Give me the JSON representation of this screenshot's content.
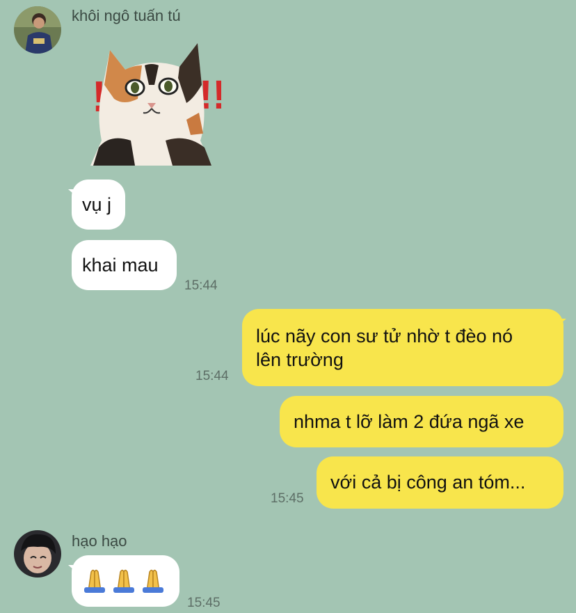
{
  "colors": {
    "background": "#a3c5b3",
    "incoming": "#ffffff",
    "outgoing": "#f8e54c"
  },
  "messages": {
    "group1": {
      "sender": "khôi ngô tuấn tú",
      "sticker": {
        "icon": "shocked-cat-sticker-icon",
        "marks": "!!"
      },
      "texts": [
        "vụ j",
        "khai mau"
      ],
      "time": "15:44"
    },
    "outgoing1": {
      "text_line1": "lúc nãy con sư tử nhờ t đèo nó",
      "text_line2": "lên trường",
      "time": "15:44"
    },
    "outgoing2": {
      "text": "nhma t lỡ làm 2 đứa ngã xe"
    },
    "outgoing3": {
      "text": "với cả bị công an tóm...",
      "time": "15:45"
    },
    "group2": {
      "sender": "hạo hạo",
      "emoji": "🙏🙏🙏",
      "emoji_icon": "folded-hands-icon",
      "time": "15:45"
    }
  }
}
